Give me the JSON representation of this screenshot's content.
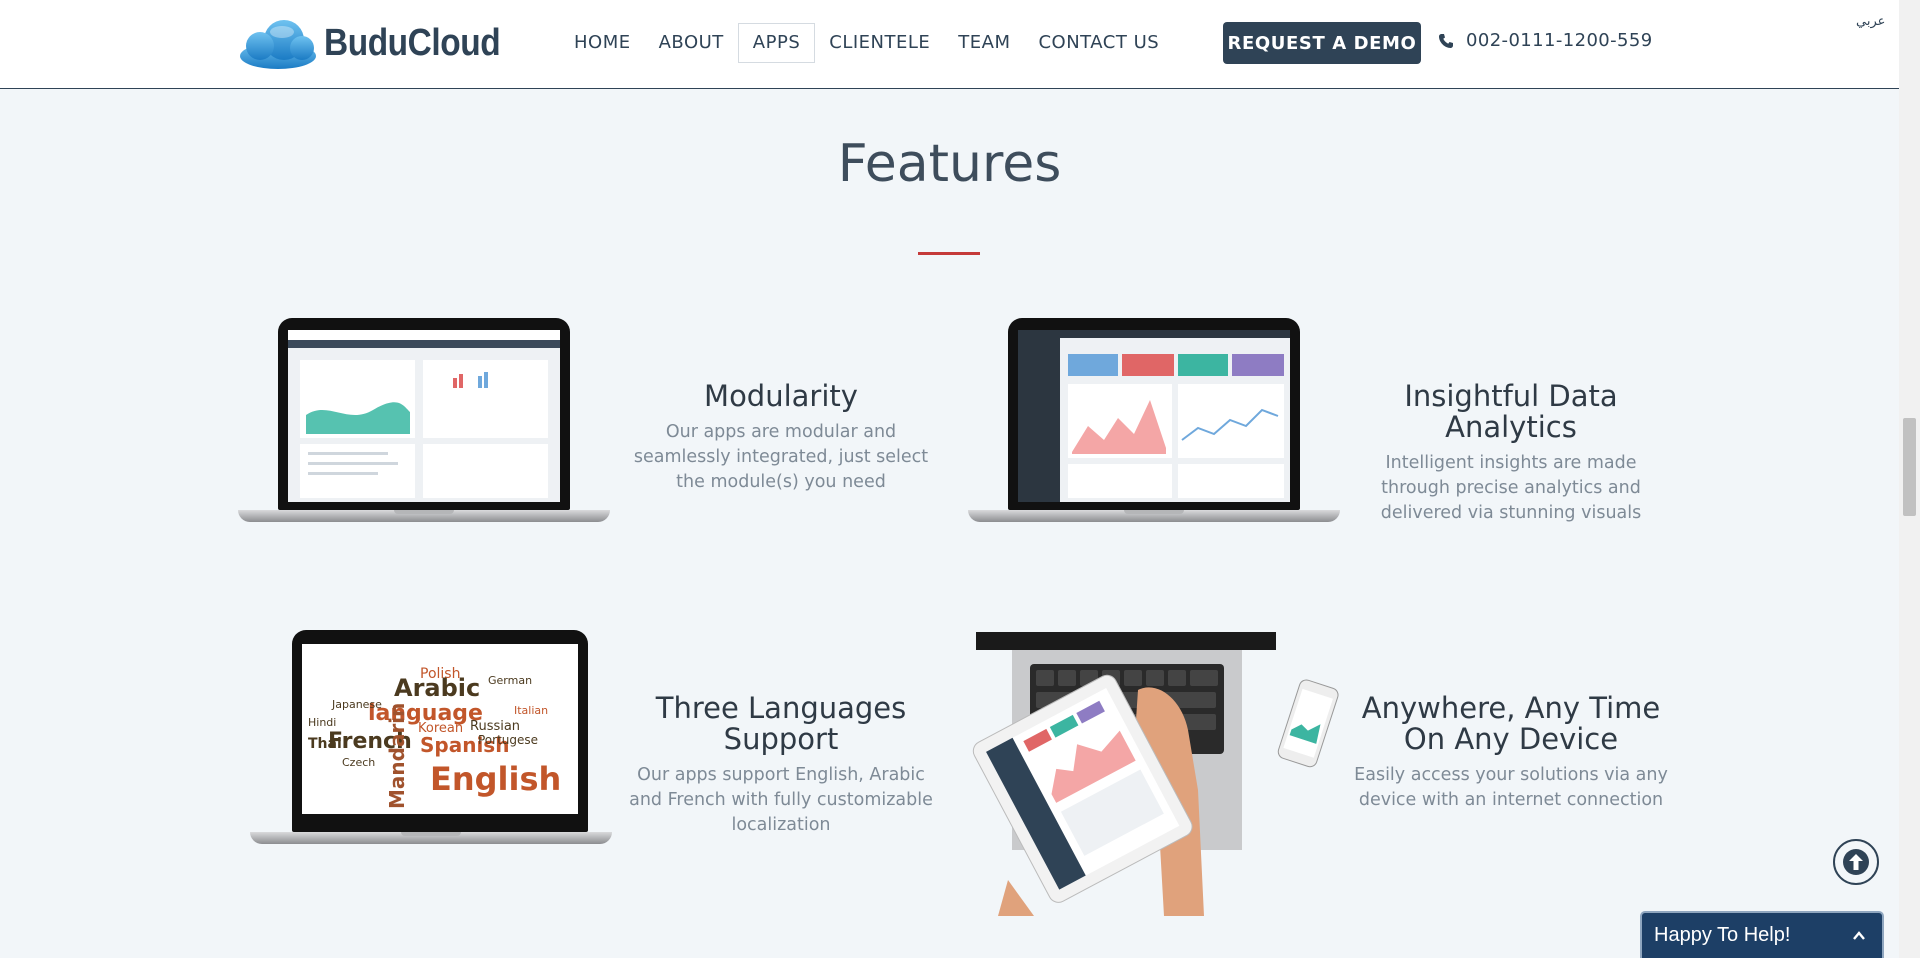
{
  "header": {
    "logo_text": "BuduCloud",
    "nav": [
      {
        "label": "HOME",
        "active": false
      },
      {
        "label": "ABOUT",
        "active": false
      },
      {
        "label": "APPS",
        "active": true
      },
      {
        "label": "CLIENTELE",
        "active": false
      },
      {
        "label": "TEAM",
        "active": false
      },
      {
        "label": "CONTACT US",
        "active": false
      }
    ],
    "demo_button": "REQUEST A DEMO",
    "phone": "002-0111-1200-559",
    "language_link": "عربي"
  },
  "section": {
    "title": "Features"
  },
  "features": [
    {
      "title": "Modularity",
      "text": "Our apps are modular and seamlessly integrated, just select the module(s) you need"
    },
    {
      "title": "Insightful Data Analytics",
      "text": "Intelligent insights are made through precise analytics and delivered via stunning visuals"
    },
    {
      "title": "Three Languages Support",
      "text": "Our apps support English, Arabic and French with fully customizable localization"
    },
    {
      "title": "Anywhere, Any Time On Any Device",
      "text": "Easily access your solutions via any device with an internet connection"
    }
  ],
  "word_cloud": [
    "Arabic",
    "language",
    "French",
    "Spanish",
    "English",
    "Mandarin",
    "Japanese",
    "Hindi",
    "Polish",
    "Russian",
    "Portugese",
    "Korean",
    "German",
    "Thai",
    "Czech",
    "Italian"
  ],
  "chat_widget": {
    "label": "Happy To Help!"
  },
  "colors": {
    "brand_navy": "#2f4356",
    "accent_red": "#c53a3a",
    "page_bg": "#f2f6f9",
    "chat_bg": "#1d3f66"
  }
}
